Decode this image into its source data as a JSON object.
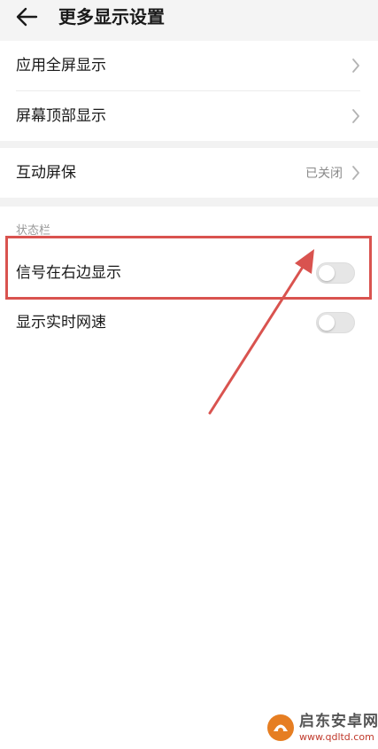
{
  "header": {
    "title": "更多显示设置",
    "back_icon": "arrow-left-icon"
  },
  "display_group": {
    "items": [
      {
        "label": "应用全屏显示",
        "icon": "chevron-right-icon"
      },
      {
        "label": "屏幕顶部显示",
        "icon": "chevron-right-icon"
      }
    ]
  },
  "screensaver": {
    "label": "互动屏保",
    "value": "已关闭",
    "icon": "chevron-right-icon"
  },
  "status_bar": {
    "section_title": "状态栏",
    "items": [
      {
        "label": "信号在右边显示",
        "enabled": false
      },
      {
        "label": "显示实时网速",
        "enabled": false
      }
    ]
  },
  "annotation": {
    "color": "#d9534f"
  },
  "watermark": {
    "name": "启东安卓网",
    "url": "www.qdltd.com",
    "logo_color": "#e67e22"
  },
  "colors": {
    "header_bg": "#f4f4f4",
    "gap_bg": "#f2f2f2",
    "toggle_off": "#e6e6e6",
    "secondary_text": "#8a8a8a"
  }
}
